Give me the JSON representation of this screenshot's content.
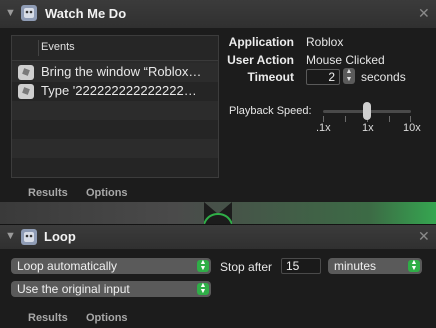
{
  "watch_me_do": {
    "title": "Watch Me Do",
    "events_header": "Events",
    "events": [
      "Bring the window “Roblox…",
      "Type '222222222222222…"
    ],
    "application_label": "Application",
    "application_value": "Roblox",
    "user_action_label": "User Action",
    "user_action_value": "Mouse Clicked",
    "timeout_label": "Timeout",
    "timeout_value": "2",
    "timeout_unit": "seconds",
    "playback_label": "Playback Speed:",
    "speed_ticks": [
      ".1x",
      "1x",
      "10x"
    ],
    "playback_speed_level": 0.5,
    "results_label": "Results",
    "options_label": "Options"
  },
  "loop": {
    "title": "Loop",
    "mode_value": "Loop automatically",
    "stop_after_label": "Stop after",
    "stop_after_value": "15",
    "unit_value": "minutes",
    "input_value": "Use the original input",
    "results_label": "Results",
    "options_label": "Options"
  },
  "colors": {
    "accent_green": "#2fae47",
    "panel_bg": "#1c1c1c"
  },
  "icons": {
    "action": "automator-robot-icon",
    "event": "mouse-click-icon",
    "close": "close-icon",
    "collapse": "chevron-down-icon"
  }
}
